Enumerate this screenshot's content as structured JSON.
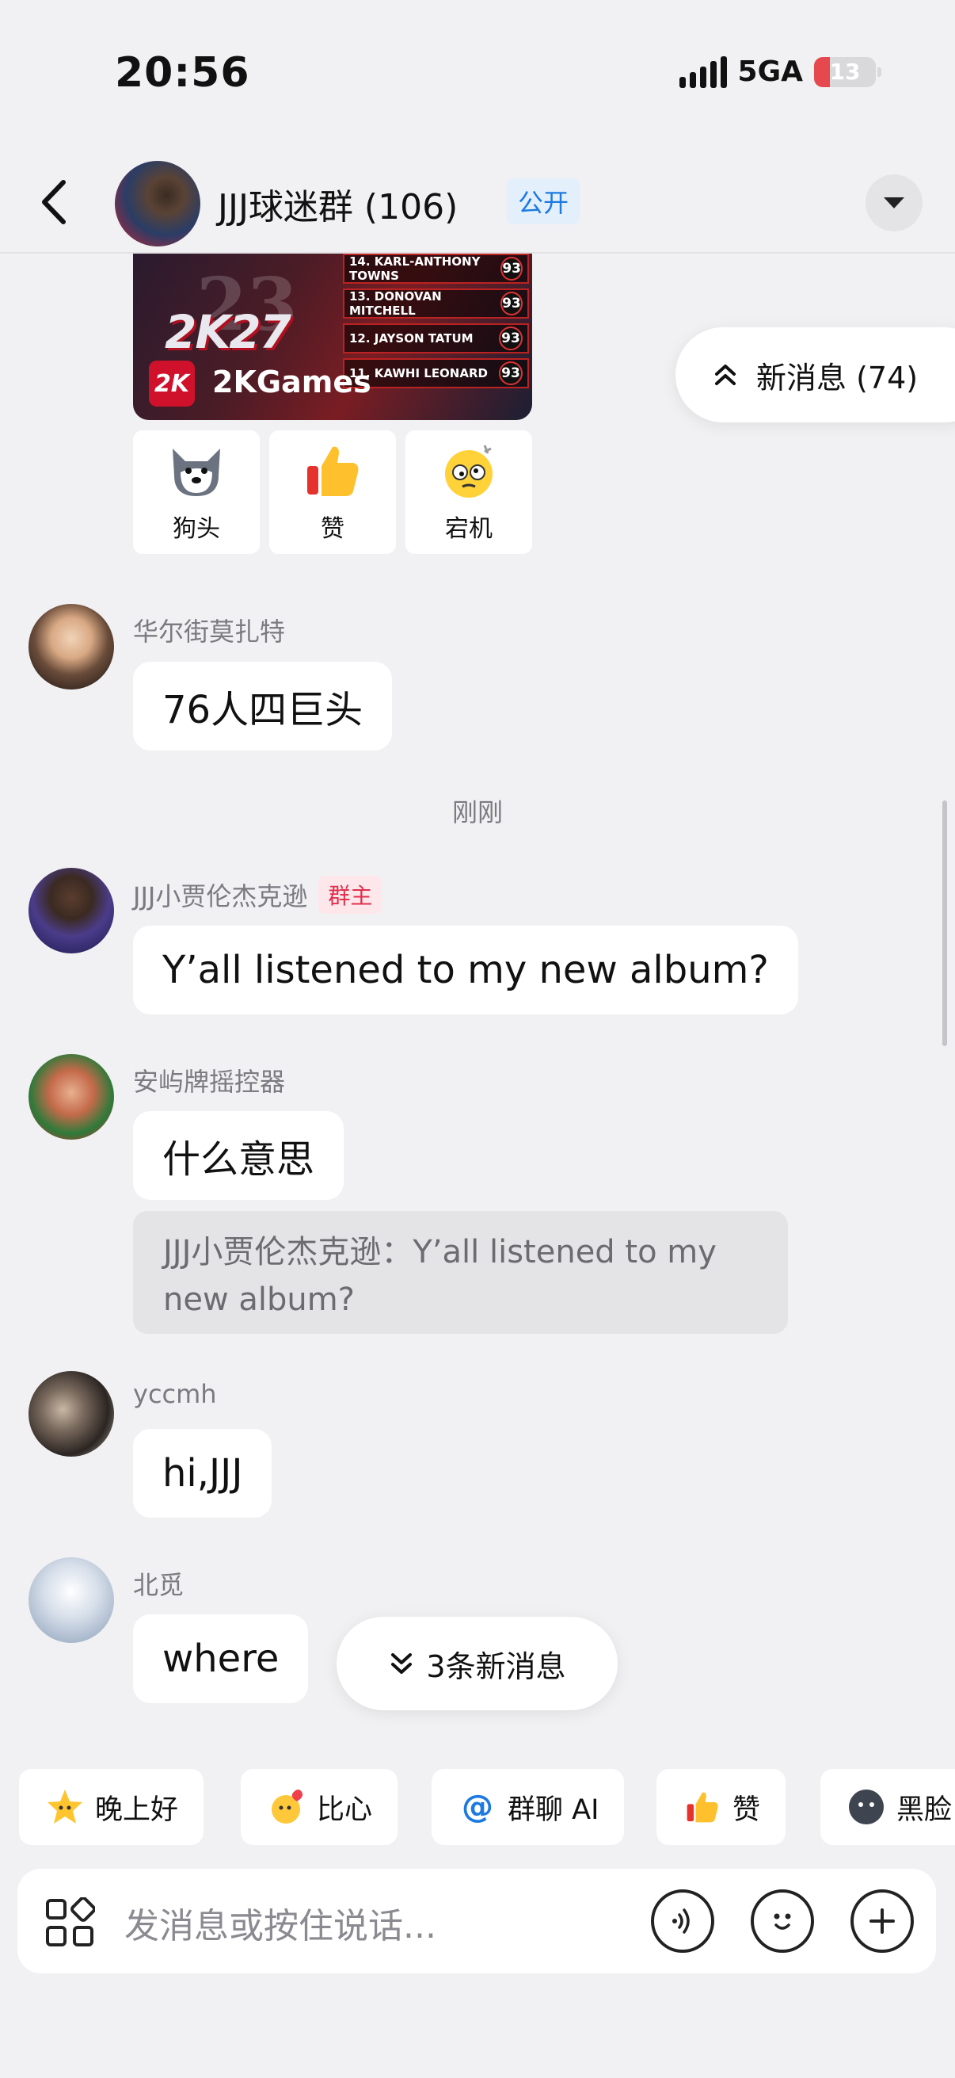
{
  "status_bar": {
    "time": "20:56",
    "network": "5GA",
    "battery": "13"
  },
  "header": {
    "title": "JJJ球迷群 (106)",
    "badge": "公开"
  },
  "shared_image": {
    "jersey_number": "23",
    "game_logo": "2K27",
    "brand_logo": "2K",
    "brand": "2KGames",
    "rankings": [
      {
        "name": "14. KARL-ANTHONY TOWNS",
        "score": "93"
      },
      {
        "name": "13. DONOVAN MITCHELL",
        "score": "93"
      },
      {
        "name": "12. JAYSON TATUM",
        "score": "93"
      },
      {
        "name": "11. KAWHI LEONARD",
        "score": "93"
      }
    ]
  },
  "reactions": [
    {
      "label": "狗头",
      "icon": "doge-icon"
    },
    {
      "label": "赞",
      "icon": "thumbs-up-icon"
    },
    {
      "label": "宕机",
      "icon": "dizzy-face-icon"
    }
  ],
  "new_messages_pill": "新消息 (74)",
  "messages": [
    {
      "sender": "华尔街莫扎特",
      "text": "76人四巨头"
    },
    {
      "sender": "JJJ小贾伦杰克逊",
      "badge": "群主",
      "text": "Y’all listened to my new album?"
    },
    {
      "sender": "安屿牌摇控器",
      "text": "什么意思",
      "quote": "JJJ小贾伦杰克逊：Y’all listened to my new album?"
    },
    {
      "sender": "yccmh",
      "text": "hi,JJJ"
    },
    {
      "sender": "北觅",
      "text": "where"
    }
  ],
  "time_divider": "刚刚",
  "bottom_pill": "3条新消息",
  "quick_replies": [
    {
      "label": "晚上好",
      "icon": "star-face-icon"
    },
    {
      "label": "比心",
      "icon": "finger-heart-icon"
    },
    {
      "label": "群聊 AI",
      "icon": "at-icon"
    },
    {
      "label": "赞",
      "icon": "thumbs-up-icon"
    },
    {
      "label": "黑脸",
      "icon": "dark-face-icon"
    }
  ],
  "input": {
    "placeholder": "发消息或按住说话..."
  },
  "colors": {
    "accent_blue": "#1d7ae0",
    "owner_red": "#e0304e",
    "background": "#f1f1f3"
  }
}
